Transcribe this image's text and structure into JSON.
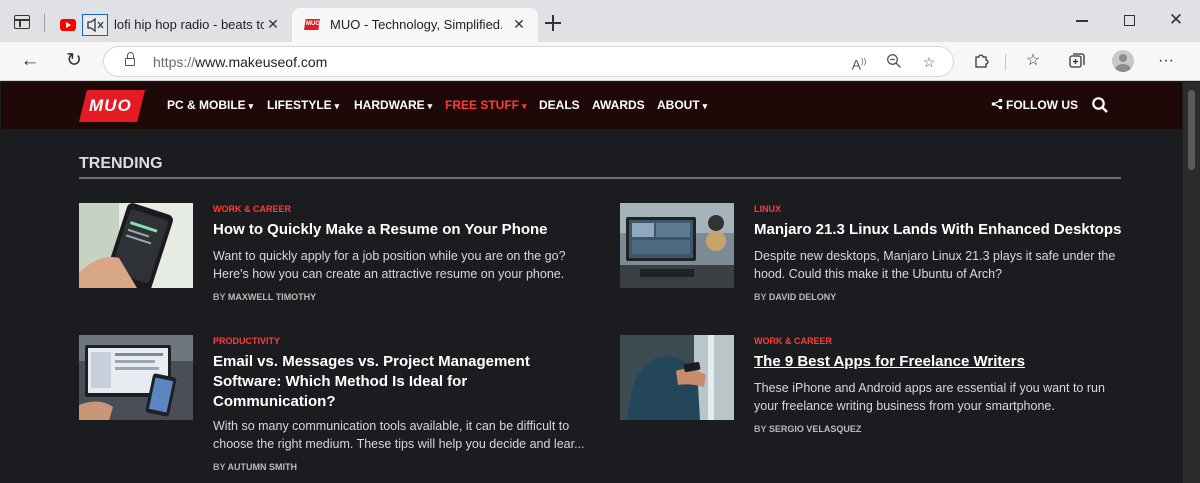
{
  "browser": {
    "tabs": [
      {
        "title": "lofi hip hop radio - beats to",
        "favicon": "youtube-icon",
        "muted": true
      },
      {
        "title": "MUO - Technology, Simplified.",
        "favicon": "muo-icon",
        "active": true
      }
    ],
    "close_glyph": "✕",
    "url_prefix": "https://",
    "url_host": "www.makeuseof.com"
  },
  "site": {
    "logo_text": "MUO",
    "accent_color": "#e41b23",
    "nav": [
      {
        "label": "PC & MOBILE",
        "dropdown": true
      },
      {
        "label": "LIFESTYLE",
        "dropdown": true
      },
      {
        "label": "HARDWARE",
        "dropdown": true
      },
      {
        "label": "FREE STUFF",
        "dropdown": true,
        "highlight": true
      },
      {
        "label": "DEALS",
        "dropdown": false
      },
      {
        "label": "AWARDS",
        "dropdown": false
      },
      {
        "label": "ABOUT",
        "dropdown": true
      }
    ],
    "follow_label": "FOLLOW US"
  },
  "trending": {
    "heading": "TRENDING",
    "articles": [
      {
        "category": "WORK & CAREER",
        "title": "How to Quickly Make a Resume on Your Phone",
        "description": "Want to quickly apply for a job position while you are on the go? Here's how you can create an attractive resume on your phone.",
        "byline_prefix": "BY",
        "author": "MAXWELL TIMOTHY"
      },
      {
        "category": "LINUX",
        "title": "Manjaro 21.3 Linux Lands With Enhanced Desktops",
        "description": "Despite new desktops, Manjaro Linux 21.3 plays it safe under the hood. Could this make it the Ubuntu of Arch?",
        "byline_prefix": "BY",
        "author": "DAVID DELONY"
      },
      {
        "category": "PRODUCTIVITY",
        "title": "Email vs. Messages vs. Project Management Software: Which Method Is Ideal for Communication?",
        "description": "With so many communication tools available, it can be difficult to choose the right medium. These tips will help you decide and lear...",
        "byline_prefix": "BY",
        "author": "AUTUMN SMITH"
      },
      {
        "category": "WORK & CAREER",
        "title": "The 9 Best Apps for Freelance Writers",
        "description": "These iPhone and Android apps are essential if you want to run your freelance writing business from your smartphone.",
        "byline_prefix": "BY",
        "author": "SERGIO VELASQUEZ"
      }
    ]
  }
}
